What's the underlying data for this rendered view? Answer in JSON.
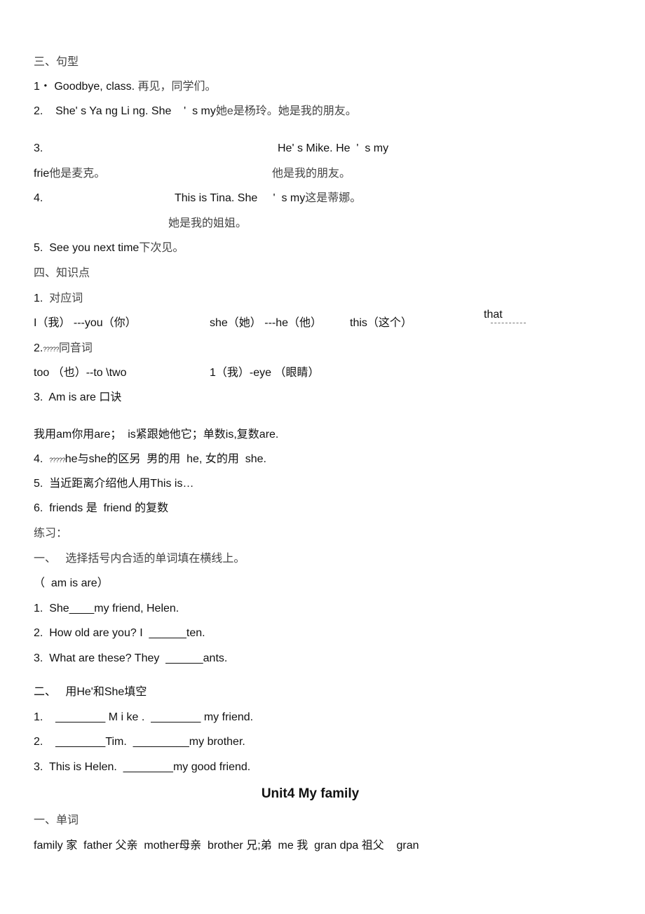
{
  "section3": {
    "heading": "三、句型",
    "s1": {
      "num": "1・",
      "en": "Goodbye, class.",
      "cn": " 再见，同学们。"
    },
    "s2": {
      "num": "2.",
      "en": "She' s Ya ng Li ng. She    '  s my",
      "cn": "她e是杨玲。她是我的朋友。"
    },
    "s3": {
      "num": "3.",
      "en": "He' s Mike. He  '  s my",
      "l2_en": "frie",
      "l2_cn": "他是麦克。",
      "l2_cn2": "他是我的朋友。"
    },
    "s4": {
      "num": "4.",
      "en": "This is Tina. She     '  s my",
      "cn": "这是蒂娜。",
      "l2_cn": "她是我的姐姐。"
    },
    "s5": {
      "num": "5.",
      "en": "See you next time",
      "cn": "下次见。"
    }
  },
  "section4": {
    "heading": "四、知识点",
    "p1": {
      "num": "1.",
      "cn": "对应词"
    },
    "pairs_row": {
      "a": "I（我） ---you（你）",
      "b": "she（她） ---he（他）",
      "c": "this（这个）",
      "d": "that"
    },
    "p2": {
      "num": "2.",
      "garbled": "?????",
      "cn": "同音词"
    },
    "homophones": {
      "a": "too （也）--to \\two",
      "b": "1（我）-eye （眼睛）"
    },
    "p3": {
      "text": "3.  Am is are 口诀"
    },
    "rhyme": "我用am你用are；  is紧跟她他它；单数is,复数are.",
    "p4": {
      "num": "4.",
      "garbled": "?????",
      "text": "he与she的区另  男的用  he, 女的用  she."
    },
    "p5": "5.  当近距离介绍他人用This is…",
    "p6": "6.  friends 是  friend 的复数"
  },
  "practice": {
    "heading": "练习：",
    "part1": {
      "heading": "一、   选择括号内合适的单词填在横线上。",
      "options": "（  am is are）",
      "items": [
        "1.  She____my friend, Helen.",
        "2.  How old are you? I  ______ten.",
        "3.  What are these? They  ______ants."
      ]
    },
    "part2": {
      "heading": "二、   用He'和She填空",
      "items": [
        "1.    ________ M i ke .  ________ my friend.",
        "2.    ________Tim.  _________my brother.",
        "3.  This is Helen.  ________my good friend."
      ]
    }
  },
  "unit4": {
    "title": "Unit4 My family",
    "vocab_heading": "一、单词",
    "vocab_line": "family 家  father 父亲  mother母亲  brother 兄;弟  me 我  gran dpa 祖父    gran"
  }
}
